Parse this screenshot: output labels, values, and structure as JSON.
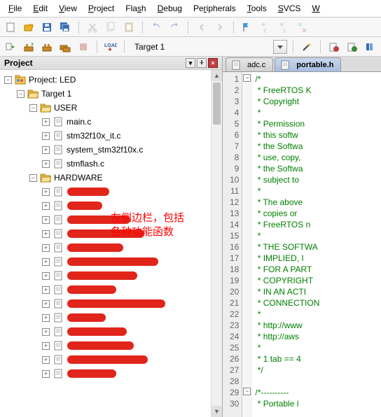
{
  "menu": {
    "items": [
      {
        "label": "File",
        "u": "F"
      },
      {
        "label": "Edit",
        "u": "E"
      },
      {
        "label": "View",
        "u": "V"
      },
      {
        "label": "Project",
        "u": "P"
      },
      {
        "label": "Flash",
        "u": "F"
      },
      {
        "label": "Debug",
        "u": "D"
      },
      {
        "label": "Peripherals",
        "u": "P"
      },
      {
        "label": "Tools",
        "u": "T"
      },
      {
        "label": "SVCS",
        "u": "S"
      },
      {
        "label": "Window",
        "u": "W"
      }
    ]
  },
  "toolbar1": {
    "icons": [
      "new",
      "open",
      "save",
      "save-all",
      "cut",
      "copy",
      "paste",
      "undo",
      "redo",
      "nav-back",
      "nav-fwd",
      "run",
      "flag",
      "step-in",
      "step-over",
      "step-out"
    ]
  },
  "toolbar2": {
    "icons": [
      "translate",
      "build",
      "rebuild",
      "batch",
      "stop",
      "download"
    ],
    "target_label": "Target 1",
    "right_icons": [
      "wand",
      "opt-target",
      "opt-file",
      "book"
    ]
  },
  "project": {
    "title": "Project",
    "root": "Project: LED",
    "target": "Target 1",
    "groups": [
      {
        "name": "USER",
        "expanded": true,
        "files": [
          "main.c",
          "stm32f10x_it.c",
          "system_stm32f10x.c",
          "stmflash.c"
        ]
      },
      {
        "name": "HARDWARE",
        "expanded": true,
        "files": [
          "",
          "",
          "",
          "",
          "",
          "",
          "",
          "",
          "",
          "",
          "",
          "",
          "",
          ""
        ]
      }
    ]
  },
  "annotation": {
    "line1": "左侧边栏，包括",
    "line2": "各种功能函数"
  },
  "editor": {
    "tabs": [
      {
        "name": "adc.c",
        "active": false
      },
      {
        "name": "portable.h",
        "active": true
      }
    ],
    "first_line": 1,
    "last_line": 30,
    "fold_minus_lines": [
      1,
      29
    ],
    "lines": [
      "/*",
      " * FreeRTOS K",
      " * Copyright ",
      " *",
      " * Permission",
      " * this softw",
      " * the Softwa",
      " * use, copy,",
      " * the Softwa",
      " * subject to",
      " *",
      " * The above ",
      " * copies or ",
      " * FreeRTOS n",
      " *",
      " * THE SOFTWA",
      " * IMPLIED, I",
      " * FOR A PART",
      " * COPYRIGHT ",
      " * IN AN ACTI",
      " * CONNECTION",
      " *",
      " * http://www",
      " * http://aws",
      " *",
      " * 1 tab == 4",
      " */",
      "",
      "/*----------",
      " * Portable l"
    ]
  },
  "colors": {
    "comment": "#008000",
    "annot": "#f00",
    "scribble": "#e1251b"
  }
}
